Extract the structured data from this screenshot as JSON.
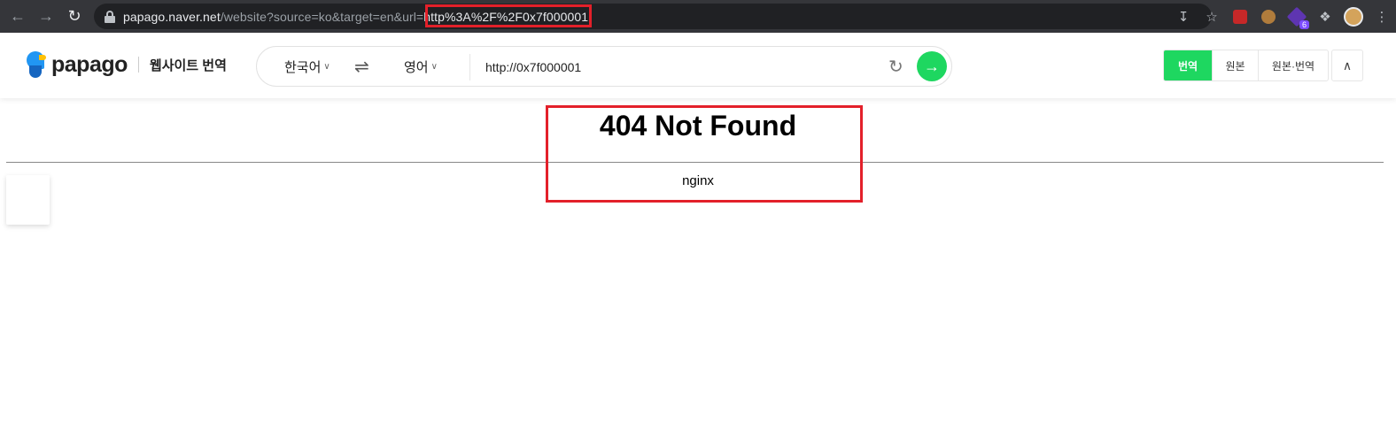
{
  "browser": {
    "url_host": "papago.naver.net",
    "url_path_prefix": "/website?source=ko&target=en&url=",
    "url_highlight": "http%3A%2F%2F0x7f000001",
    "extension_badge": "6",
    "highlight_color": "#e3202a"
  },
  "papago": {
    "logo_text": "papago",
    "logo_subtitle": "웹사이트 번역",
    "source_lang": "한국어",
    "target_lang": "영어",
    "url_value": "http://0x7f000001",
    "tabs": [
      "번역",
      "원본",
      "원본·번역"
    ],
    "accent_color": "#1ed760"
  },
  "page": {
    "title": "404 Not Found",
    "footer": "nginx"
  }
}
